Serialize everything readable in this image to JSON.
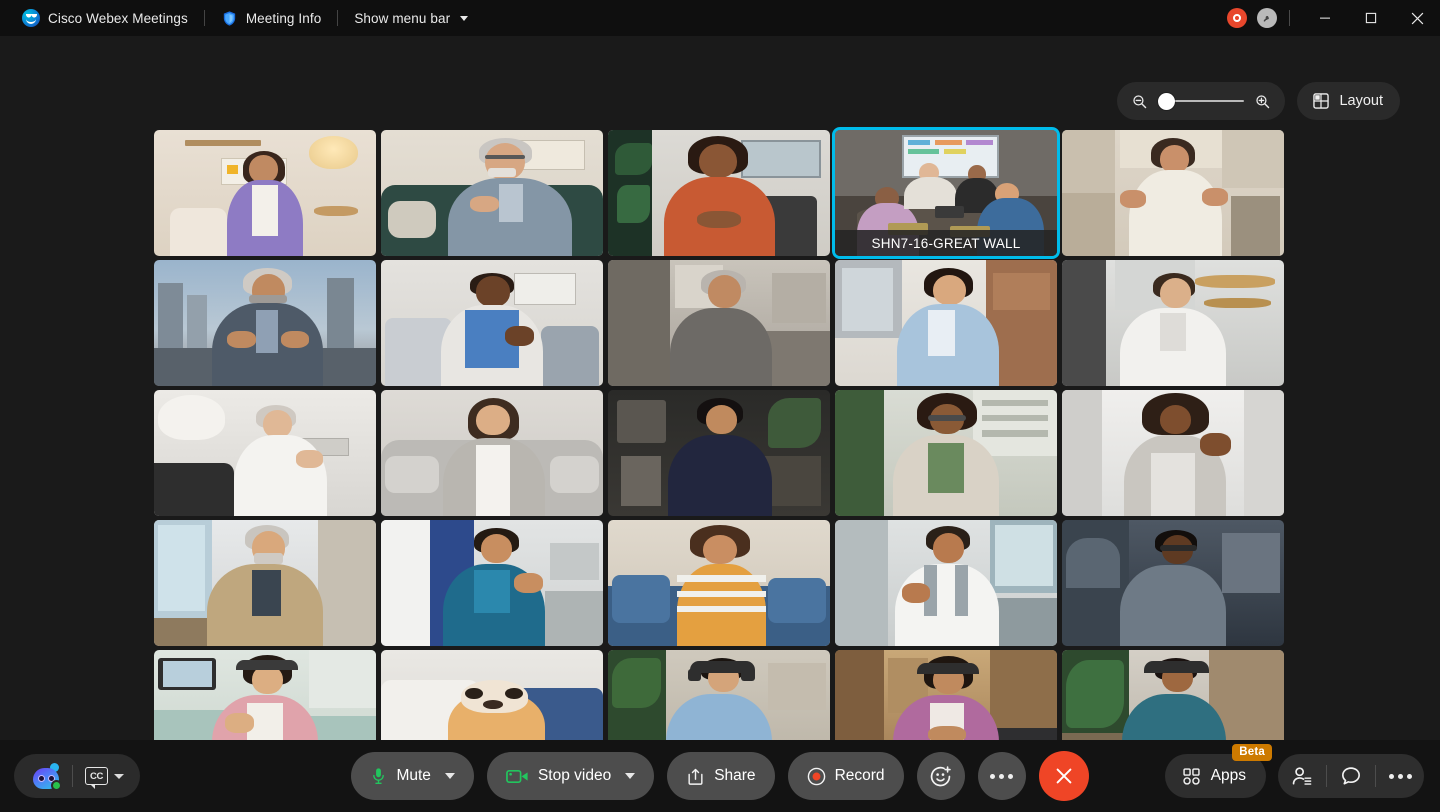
{
  "window": {
    "app_title": "Cisco Webex Meetings",
    "meeting_info_label": "Meeting Info",
    "menu_bar_label": "Show menu bar",
    "logo_icon": "webex-logo-icon",
    "shield_icon": "shield-icon",
    "recording_indicator_icon": "recording-indicator-icon",
    "encryption_icon": "key-icon",
    "minimize_icon": "minimize-icon",
    "maximize_icon": "maximize-icon",
    "close_icon": "close-icon"
  },
  "stage": {
    "zoom_out_icon": "zoom-out-icon",
    "zoom_in_icon": "zoom-in-icon",
    "zoom_slider_value": 0,
    "layout_label": "Layout",
    "layout_icon": "grid-layout-icon"
  },
  "grid": {
    "rows": 5,
    "columns": 5,
    "active_tile_index": 3,
    "active_tile_border_color": "#00bceb",
    "tiles": [
      {
        "name": "",
        "scene": "t1"
      },
      {
        "name": "",
        "scene": "t2"
      },
      {
        "name": "",
        "scene": "t3"
      },
      {
        "name": "SHN7-16-GREAT WALL",
        "scene": "t4"
      },
      {
        "name": "",
        "scene": "t5"
      },
      {
        "name": "",
        "scene": "t6"
      },
      {
        "name": "",
        "scene": "t7"
      },
      {
        "name": "",
        "scene": "t8"
      },
      {
        "name": "",
        "scene": "t9"
      },
      {
        "name": "",
        "scene": "t10"
      },
      {
        "name": "",
        "scene": "t11"
      },
      {
        "name": "",
        "scene": "t12"
      },
      {
        "name": "",
        "scene": "t13"
      },
      {
        "name": "",
        "scene": "t14"
      },
      {
        "name": "",
        "scene": "t15"
      },
      {
        "name": "",
        "scene": "t16"
      },
      {
        "name": "",
        "scene": "t17"
      },
      {
        "name": "",
        "scene": "t18"
      },
      {
        "name": "",
        "scene": "t19"
      },
      {
        "name": "",
        "scene": "t20"
      },
      {
        "name": "",
        "scene": "t21"
      },
      {
        "name": "",
        "scene": "t22"
      },
      {
        "name": "",
        "scene": "t23"
      },
      {
        "name": "",
        "scene": "t24"
      },
      {
        "name": "",
        "scene": "t25"
      }
    ]
  },
  "toolbar": {
    "assistant_icon": "webex-assistant-icon",
    "assistant_status_color": "#29c24a",
    "captions_label": "CC",
    "captions_icon": "closed-captions-icon",
    "captions_caret_icon": "chevron-down-icon",
    "mute_label": "Mute",
    "mute_icon": "microphone-icon",
    "mute_icon_color": "#22c55e",
    "mute_caret_icon": "chevron-down-icon",
    "video_label": "Stop video",
    "video_icon": "camera-icon",
    "video_icon_color": "#22c55e",
    "video_caret_icon": "chevron-down-icon",
    "share_label": "Share",
    "share_icon": "share-upload-icon",
    "record_label": "Record",
    "record_icon": "record-dot-icon",
    "record_icon_color": "#ef4526",
    "reactions_icon": "smiley-plus-icon",
    "more_icon": "more-horizontal-icon",
    "leave_label": "",
    "leave_icon": "close-icon",
    "leave_color": "#ef4526",
    "apps_label": "Apps",
    "apps_icon": "apps-grid-icon",
    "apps_badge": "Beta",
    "participants_icon": "participants-icon",
    "chat_icon": "chat-bubble-icon",
    "more_options_icon": "more-horizontal-icon"
  }
}
